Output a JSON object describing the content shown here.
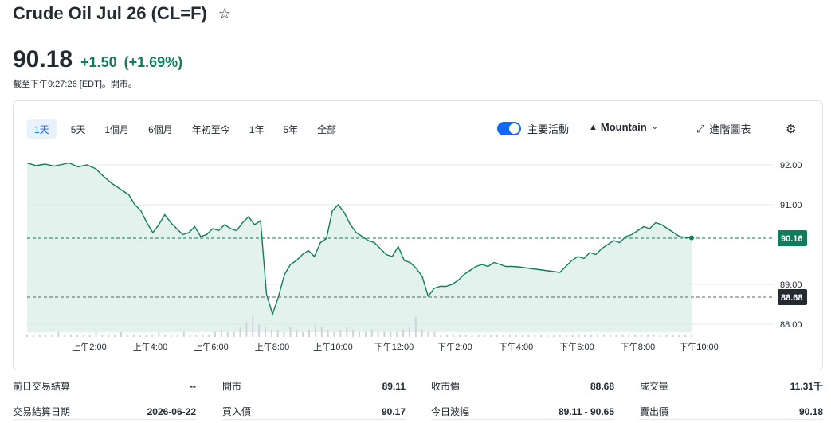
{
  "header": {
    "title": "Crude Oil Jul 26 (CL=F)",
    "star_icon": "star-outline-icon"
  },
  "quote": {
    "price": "90.18",
    "change": "+1.50",
    "change_pct": "(+1.69%)",
    "as_of": "截至下午9:27:26 [EDT]。開市。",
    "positive_color": "#0d7d5b"
  },
  "toolbar": {
    "ranges": [
      "1天",
      "5天",
      "1個月",
      "6個月",
      "年初至今",
      "1年",
      "5年",
      "全部"
    ],
    "active_range": "1天",
    "key_events_label": "主要活動",
    "key_events_on": true,
    "chart_type_label": "Mountain",
    "advanced_label": "進階圖表",
    "accent_color": "#0f69ff"
  },
  "chart_data": {
    "type": "area",
    "x_tick_labels": [
      "上午2:00",
      "上午4:00",
      "上午6:00",
      "上午8:00",
      "上午10:00",
      "下午12:00",
      "下午2:00",
      "下午4:00",
      "下午6:00",
      "下午8:00",
      "下午10:00"
    ],
    "y_tick_labels": [
      "92.00",
      "91.00",
      "89.00",
      "88.00"
    ],
    "ylim": [
      87.8,
      92.2
    ],
    "series": [
      {
        "x": [
          0.0,
          0.3,
          0.6,
          0.9,
          1.1,
          1.4,
          1.7,
          2.0,
          2.3,
          2.5,
          2.8,
          3.1,
          3.4,
          3.6,
          3.8,
          4.0,
          4.2,
          4.4,
          4.6,
          4.8,
          5.0,
          5.2,
          5.4,
          5.6,
          5.8,
          6.0,
          6.2,
          6.4,
          6.6,
          6.8,
          7.0,
          7.2,
          7.4,
          7.6,
          7.8,
          8.0,
          8.2,
          8.4,
          8.6,
          8.8,
          9.0,
          9.2,
          9.4,
          9.6,
          9.8,
          10.0,
          10.2,
          10.4,
          10.6,
          10.8,
          11.0,
          11.2,
          11.4,
          11.6,
          11.8,
          12.0,
          12.2,
          12.4,
          12.6,
          12.8,
          13.0,
          13.2,
          13.4,
          13.6,
          13.8,
          14.0,
          14.2,
          14.4,
          14.6,
          14.8,
          15.0,
          15.2,
          15.4,
          15.6,
          15.8,
          16.0,
          16.2,
          16.4,
          16.6,
          16.8,
          17.0,
          17.2,
          17.4,
          17.6,
          17.8,
          18.0,
          18.2,
          18.4,
          18.6,
          18.8,
          19.0,
          19.2,
          19.4,
          19.6,
          19.8,
          20.0,
          20.2,
          20.4,
          20.6,
          20.8,
          21.0,
          21.2,
          21.4,
          21.6,
          21.8,
          22.0,
          22.2
        ],
        "y": [
          92.05,
          91.98,
          92.02,
          91.97,
          92.0,
          92.05,
          91.95,
          92.0,
          91.9,
          91.75,
          91.55,
          91.4,
          91.25,
          91.0,
          90.85,
          90.55,
          90.3,
          90.5,
          90.75,
          90.55,
          90.4,
          90.25,
          90.3,
          90.45,
          90.2,
          90.25,
          90.4,
          90.35,
          90.5,
          90.4,
          90.35,
          90.55,
          90.7,
          90.5,
          90.6,
          88.75,
          88.25,
          88.7,
          89.25,
          89.5,
          89.6,
          89.75,
          89.85,
          89.7,
          90.05,
          90.15,
          90.85,
          91.0,
          90.8,
          90.5,
          90.3,
          90.2,
          90.1,
          90.05,
          89.9,
          89.75,
          89.7,
          89.95,
          89.6,
          89.55,
          89.4,
          89.2,
          88.7,
          88.9,
          88.95,
          88.95,
          89.0,
          89.1,
          89.25,
          89.35,
          89.45,
          89.5,
          89.45,
          89.55,
          89.5,
          89.45,
          89.45,
          89.44,
          89.42,
          89.4,
          89.38,
          89.36,
          89.34,
          89.32,
          89.3,
          89.45,
          89.6,
          89.7,
          89.65,
          89.8,
          89.75,
          89.9,
          90.0,
          90.1,
          90.05,
          90.2,
          90.25,
          90.35,
          90.45,
          90.4,
          90.55,
          90.5,
          90.4,
          90.3,
          90.2,
          90.18,
          90.17
        ]
      }
    ],
    "volume": [
      1,
      1,
      1,
      1,
      1,
      2,
      1,
      1,
      1,
      1,
      1,
      2,
      1,
      1,
      1,
      2,
      1,
      1,
      1,
      1,
      1,
      2,
      1,
      1,
      1,
      2,
      1,
      1,
      1,
      1,
      2,
      3,
      2,
      2,
      4,
      6,
      9,
      5,
      4,
      3,
      3,
      2,
      4,
      3,
      2,
      3,
      5,
      4,
      3,
      2,
      3,
      4,
      3,
      2,
      2,
      3,
      2,
      2,
      2,
      2,
      3,
      4,
      8,
      3,
      2,
      2,
      1,
      1,
      1,
      1,
      1,
      1,
      1,
      1,
      1,
      1,
      1,
      1,
      1,
      1,
      1,
      1,
      1,
      1,
      1,
      1,
      1,
      1,
      1,
      1,
      1,
      1,
      1,
      1,
      1,
      1,
      1,
      1,
      1,
      1,
      1,
      1,
      1,
      1,
      1,
      1,
      1
    ],
    "current_price_tag": "90.16",
    "prev_close_tag": "88.68",
    "current_value": 90.16,
    "prev_close_value": 88.68,
    "line_color": "#0d7d5b",
    "fill_color": "#d9ede5",
    "grid": true
  },
  "stats": {
    "col1": [
      {
        "label": "前日交易結算",
        "value": "--"
      },
      {
        "label": "交易結算日期",
        "value": "2026-06-22"
      }
    ],
    "col2": [
      {
        "label": "開市",
        "value": "89.11"
      },
      {
        "label": "買入價",
        "value": "90.17"
      }
    ],
    "col3": [
      {
        "label": "收市價",
        "value": "88.68"
      },
      {
        "label": "今日波幅",
        "value": "89.11 - 90.65"
      }
    ],
    "col4": [
      {
        "label": "成交量",
        "value": "11.31千"
      },
      {
        "label": "賣出價",
        "value": "90.18"
      }
    ]
  }
}
